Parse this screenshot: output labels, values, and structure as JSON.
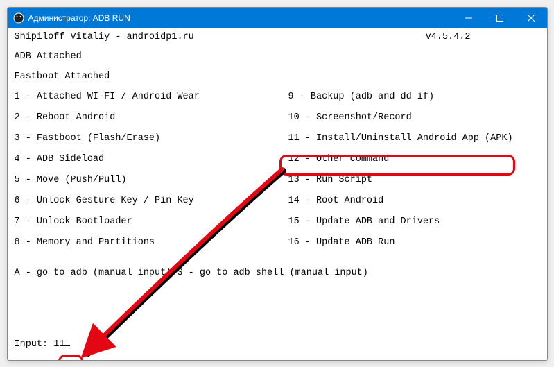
{
  "titlebar": {
    "title": "Администратор:  ADB RUN"
  },
  "header": {
    "author": "Shipiloff Vitaliy  - androidp1.ru",
    "version": "v4.5.4.2"
  },
  "status": {
    "adb": "ADB Attached",
    "fastboot": "Fastboot Attached"
  },
  "menu_left": [
    "1 - Attached WI-FI / Android Wear",
    "2 - Reboot Android",
    "3 - Fastboot (Flash/Erase)",
    "4 - ADB Sideload",
    "5 - Move (Push/Pull)",
    "6 - Unlock Gesture Key / Pin Key",
    "7 - Unlock Bootloader",
    "8 - Memory and Partitions"
  ],
  "menu_right": [
    " 9 - Backup (adb and dd if)",
    "10 - Screenshot/Record",
    "11 - Install/Uninstall Android App (APK)",
    "12 - Other command",
    "13 - Run Script",
    "14 - Root Android",
    "15 - Update ADB and Drivers",
    "16 - Update ADB Run"
  ],
  "footer": {
    "hint": "A - go to adb (manual input)    S - go to adb shell (manual input)",
    "prompt": "Input: ",
    "value": "11"
  }
}
